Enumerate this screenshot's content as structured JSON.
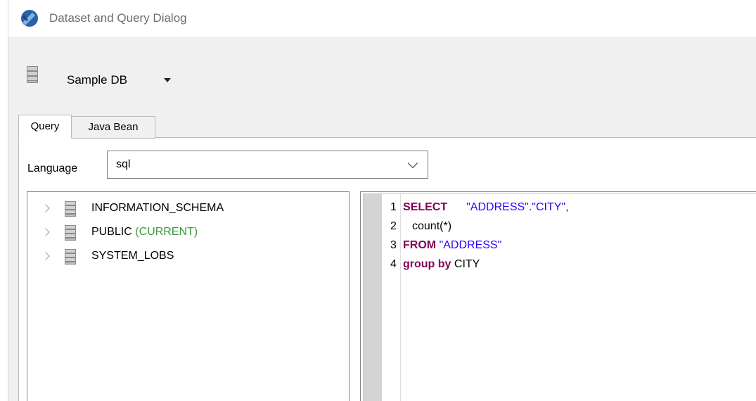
{
  "window": {
    "title": "Dataset and Query Dialog"
  },
  "datasource": {
    "name": "Sample DB"
  },
  "tabs": [
    {
      "label": "Query",
      "active": true
    },
    {
      "label": "Java Bean",
      "active": false
    }
  ],
  "language": {
    "label": "Language",
    "value": "sql"
  },
  "schema_tree": {
    "items": [
      {
        "name": "INFORMATION_SCHEMA",
        "suffix": ""
      },
      {
        "name": "PUBLIC",
        "suffix": "(CURRENT)"
      },
      {
        "name": "SYSTEM_LOBS",
        "suffix": ""
      }
    ]
  },
  "editor": {
    "lines": [
      {
        "number": "1",
        "keyword": "SELECT",
        "text": "\"ADDRESS\".\"CITY\","
      },
      {
        "number": "2",
        "keyword": "",
        "text": "count(*)"
      },
      {
        "number": "3",
        "keyword": "FROM",
        "text": "\"ADDRESS\""
      },
      {
        "number": "4",
        "keyword": "group by",
        "text": "CITY"
      }
    ]
  },
  "colors": {
    "keyword": "#7f0055",
    "string": "#2a00ff",
    "current_schema": "#3a9a3a"
  }
}
